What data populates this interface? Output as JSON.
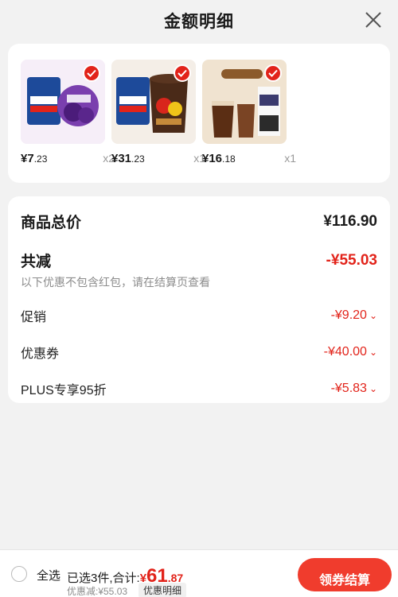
{
  "header": {
    "title": "金额明细"
  },
  "products": [
    {
      "price_int": "¥7",
      "price_dec": ".23",
      "qty": "x2",
      "image_name": "jelly-product-image",
      "colors": [
        "#f2e9f5",
        "#6a3fa0"
      ]
    },
    {
      "price_int": "¥31",
      "price_dec": ".23",
      "qty": "x1",
      "image_name": "chocolate-product-image",
      "colors": [
        "#f3ede6",
        "#4a2a18"
      ]
    },
    {
      "price_int": "¥16",
      "price_dec": ".18",
      "qty": "x1",
      "image_name": "coffee-product-image",
      "colors": [
        "#efe2cf",
        "#6b3b1f"
      ]
    }
  ],
  "summary": {
    "total_label": "商品总价",
    "total_value": "¥116.90",
    "reduction_label": "共减",
    "reduction_value": "-¥55.03",
    "note": "以下优惠不包含红包，请在结算页查看",
    "items": [
      {
        "label": "促销",
        "value": "-¥9.20"
      },
      {
        "label": "优惠券",
        "value": "-¥40.00"
      },
      {
        "label": "PLUS专享95折",
        "value": "-¥5.83"
      }
    ]
  },
  "bottom": {
    "select_all": "全选",
    "selected_text": "已选3件,合计:",
    "total_yen": "¥",
    "total_int": "61",
    "total_dec": ".87",
    "discount_line": "优惠减:¥55.03",
    "detail_button": "优惠明细",
    "checkout_button": "领券结算"
  },
  "colors": {
    "accent": "#e2231a",
    "button": "#f03c2d"
  }
}
